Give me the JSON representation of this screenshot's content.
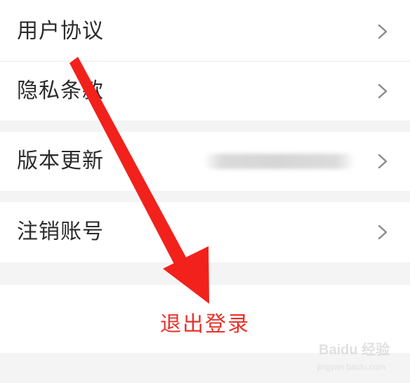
{
  "settings": {
    "items": [
      {
        "label": "用户协议"
      },
      {
        "label": "隐私条款"
      },
      {
        "label": "版本更新"
      },
      {
        "label": "注销账号"
      }
    ]
  },
  "logout": {
    "label": "退出登录"
  },
  "annotation": {
    "arrow_color": "#f2211c"
  },
  "colors": {
    "background": "#f4f4f4",
    "row": "#ffffff",
    "text": "#2b2b2b",
    "logout_text": "#e8322b",
    "chevron": "#8a8a8a"
  },
  "icons": {
    "chevron": "chevron-right-icon",
    "annotation": "red-arrow-annotation"
  },
  "watermark": {
    "text": "Baidu 经验",
    "url": "jingyan.baidu.com"
  }
}
